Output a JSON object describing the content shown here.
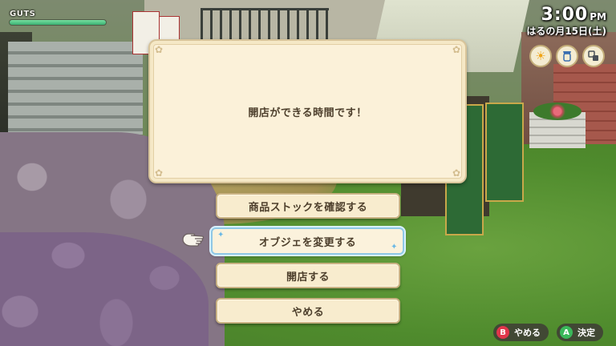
{
  "hud": {
    "guts_label": "GUTS",
    "guts_fill_percent": 100,
    "clock_time": "3:00",
    "clock_ampm": "PM",
    "clock_date": "はるの月15日(土)",
    "status_icons": [
      "sun-weather-icon",
      "seed-bag-icon",
      "cycle-tool-icon"
    ]
  },
  "dialog": {
    "message": "開店ができる時間です！"
  },
  "menu": {
    "options": [
      "商品ストックを確認する",
      "オブジェを変更する",
      "開店する",
      "やめる"
    ],
    "selected_index": 1
  },
  "prompts": {
    "b_key": "B",
    "b_label": "やめる",
    "a_key": "A",
    "a_label": "決定"
  },
  "colors": {
    "guts_bar": "#3aaf72",
    "dialog_bg": "#fbf1d9",
    "selected_border": "#8fc8e6",
    "b_button": "#e0364a",
    "a_button": "#3ab85a"
  }
}
